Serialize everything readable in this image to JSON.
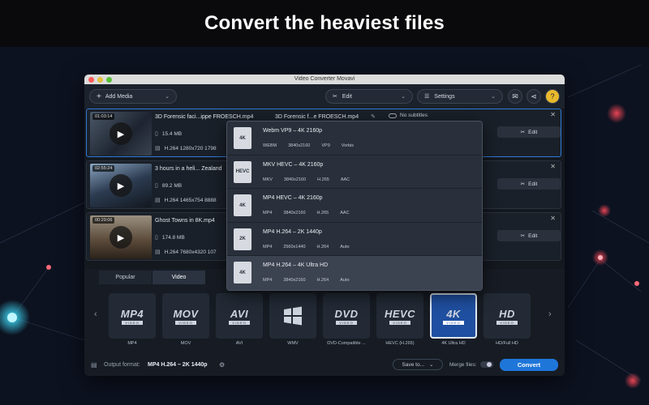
{
  "banner": {
    "headline": "Convert the heaviest files"
  },
  "window": {
    "title": "Video Converter Movavi",
    "toolbar": {
      "add_media": "Add Media",
      "edit": "Edit",
      "settings": "Settings"
    }
  },
  "files": [
    {
      "duration": "01:03:14",
      "name": "3D Forensic faci...ippe FROESCH.mp4",
      "output_name": "3D Forensic f...e FROESCH.mp4",
      "size": "15.4 MB",
      "video": "H.264 1280x720 1798",
      "subtitles": "No subtitles",
      "edit": "Edit"
    },
    {
      "duration": "02:55:24",
      "name": "3 hours in a heli... Zealand",
      "size": "89.2 MB",
      "video": "H.264 1465x754 8888",
      "edit": "Edit"
    },
    {
      "duration": "00:29:06",
      "name": "Ghost Towns in 8K.mp4",
      "size": "174.8 MB",
      "video": "H.264 7680x4320 107",
      "edit": "Edit"
    }
  ],
  "presets": [
    {
      "title": "Webm VP9 – 4K 2160p",
      "icon": "4K",
      "specs": [
        "WEBM",
        "3840x2160",
        "VP9",
        "Vorbis"
      ]
    },
    {
      "title": "MKV HEVC – 4K 2160p",
      "icon": "HEVC",
      "specs": [
        "MKV",
        "3840x2160",
        "H.265",
        "AAC"
      ]
    },
    {
      "title": "MP4 HEVC – 4K 2160p",
      "icon": "4K",
      "specs": [
        "MP4",
        "3840x2160",
        "H.265",
        "AAC"
      ]
    },
    {
      "title": "MP4 H.264 – 2K 1440p",
      "icon": "2K",
      "specs": [
        "MP4",
        "2560x1440",
        "H.264",
        "Auto"
      ]
    },
    {
      "title": "MP4 H.264 – 4K Ultra HD",
      "icon": "4K",
      "specs": [
        "MP4",
        "3840x2160",
        "H.264",
        "Auto"
      ]
    }
  ],
  "format_tabs": [
    "Popular",
    "Video"
  ],
  "formats": [
    {
      "logo": "MP4",
      "sub": "VIDEO",
      "label": "MP4"
    },
    {
      "logo": "MOV",
      "sub": "VIDEO",
      "label": "MOV"
    },
    {
      "logo": "AVI",
      "sub": "VIDEO",
      "label": "AVI"
    },
    {
      "logo": "",
      "sub": "",
      "label": "WMV"
    },
    {
      "logo": "DVD",
      "sub": "VIDEO",
      "label": "DVD-Compatible ..."
    },
    {
      "logo": "HEVC",
      "sub": "VIDEO",
      "label": "HEVC (H.265)"
    },
    {
      "logo": "4K",
      "sub": "VIDEO",
      "label": "4K Ultra HD"
    },
    {
      "logo": "HD",
      "sub": "VIDEO",
      "label": "HD/Full HD"
    }
  ],
  "footer": {
    "output_label": "Output format:",
    "output_value": "MP4 H.264 – 2K 1440p",
    "save_to": "Save to...",
    "merge_label": "Merge files:",
    "convert": "Convert"
  },
  "colors": {
    "accent": "#1f76d9",
    "selected": "#2f7bd6"
  }
}
